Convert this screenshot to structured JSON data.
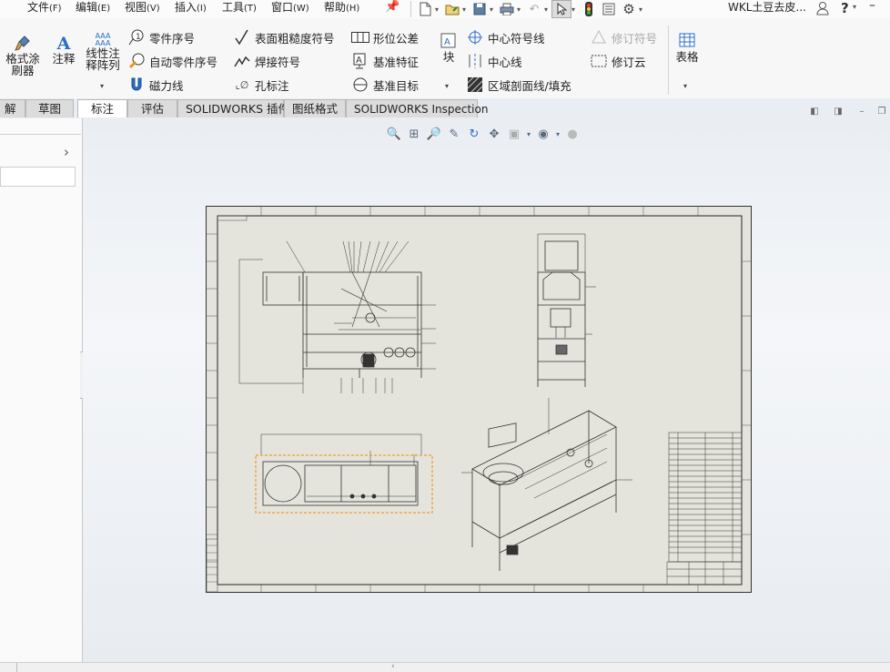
{
  "menubar": {
    "items": [
      {
        "label": "文件",
        "accel": "(F)"
      },
      {
        "label": "编辑",
        "accel": "(E)"
      },
      {
        "label": "视图",
        "accel": "(V)"
      },
      {
        "label": "插入",
        "accel": "(I)"
      },
      {
        "label": "工具",
        "accel": "(T)"
      },
      {
        "label": "窗口",
        "accel": "(W)"
      },
      {
        "label": "帮助",
        "accel": "(H)"
      }
    ],
    "document_title": "WKL土豆去皮..."
  },
  "command_manager": {
    "format_painter": "格式涂\n刷器",
    "note": "注释",
    "linear_note_pattern": "线性注\n释阵列",
    "balloon": "零件序号",
    "auto_balloon": "自动零件序号",
    "magnetic_line": "磁力线",
    "surface_finish": "表面粗糙度符号",
    "weld_symbol": "焊接符号",
    "hole_callout": "孔标注",
    "geometric_tolerance": "形位公差",
    "datum_feature": "基准特征",
    "datum_target": "基准目标",
    "block": "块",
    "center_mark": "中心符号线",
    "centerline": "中心线",
    "area_hatch": "区域剖面线/填充",
    "revision_symbol": "修订符号",
    "revision_cloud": "修订云",
    "table": "表格"
  },
  "tabs": [
    {
      "label": "解",
      "active": false
    },
    {
      "label": "草图",
      "active": false
    },
    {
      "label": "标注",
      "active": true
    },
    {
      "label": "评估",
      "active": false
    },
    {
      "label": "SOLIDWORKS 插件",
      "active": false
    },
    {
      "label": "图纸格式",
      "active": false
    },
    {
      "label": "SOLIDWORKS Inspection",
      "active": false
    }
  ],
  "colors": {
    "sheet": "#e4e4dc",
    "selection": "#f08a00",
    "accent": "#2b6fc4"
  }
}
